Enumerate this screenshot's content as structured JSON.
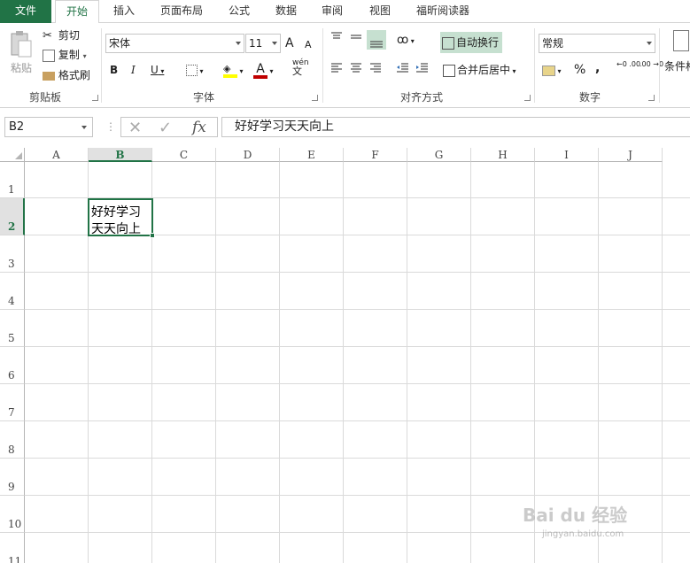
{
  "tabs": [
    "文件",
    "开始",
    "插入",
    "页面布局",
    "公式",
    "数据",
    "审阅",
    "视图",
    "福昕阅读器"
  ],
  "clipboard": {
    "paste": "粘贴",
    "cut": "剪切",
    "copy": "复制",
    "format_painter": "格式刷",
    "label": "剪贴板"
  },
  "font": {
    "name": "宋体",
    "size": "11",
    "bold": "B",
    "italic": "I",
    "underline": "U",
    "grow": "A",
    "shrink": "A",
    "pinyin_top": "wén",
    "pinyin_bottom": "文",
    "label": "字体"
  },
  "alignment": {
    "wrap_text": "自动换行",
    "merge_center": "合并后居中",
    "label": "对齐方式"
  },
  "number": {
    "format": "常规",
    "percent": "%",
    "comma": ",",
    "inc_dec": "←0 .00",
    "dec_dec": ".00 →0",
    "label": "数字"
  },
  "styles": {
    "conditional": "条件格"
  },
  "formula_bar": {
    "name_box": "B2",
    "fx": "fx",
    "content": "好好学习天天向上"
  },
  "columns": [
    "A",
    "B",
    "C",
    "D",
    "E",
    "F",
    "G",
    "H",
    "I",
    "J"
  ],
  "rows": [
    "1",
    "2",
    "3",
    "4",
    "5",
    "6",
    "7",
    "8",
    "9",
    "10",
    "11"
  ],
  "selected_cell": {
    "column": "B",
    "row": "2",
    "text": "好好学习\n天天向上"
  },
  "colors": {
    "accent": "#217346",
    "font_color": "#c00000",
    "highlight": "#ffff00"
  },
  "watermark": {
    "text": "Bai du 经验",
    "url": "jingyan.baidu.com"
  }
}
